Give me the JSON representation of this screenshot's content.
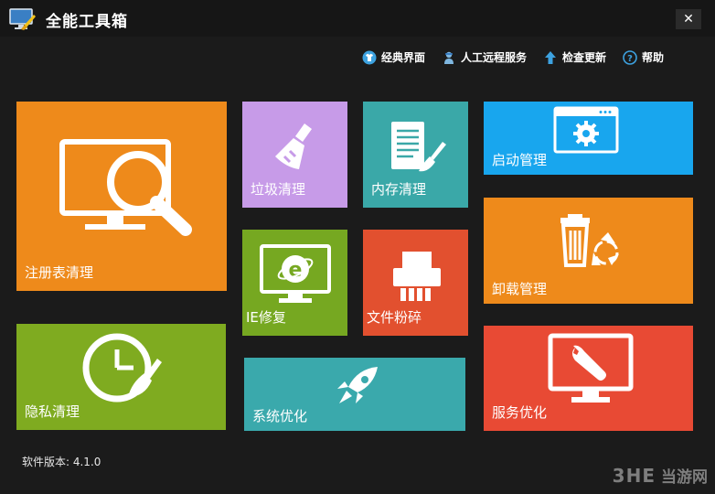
{
  "window": {
    "title": "全能工具箱",
    "close_glyph": "✕"
  },
  "toolbar": {
    "items": [
      {
        "label": "经典界面",
        "icon": "tshirt-icon"
      },
      {
        "label": "人工远程服务",
        "icon": "support-person-icon"
      },
      {
        "label": "检查更新",
        "icon": "arrow-up-icon"
      },
      {
        "label": "帮助",
        "icon": "help-icon"
      }
    ]
  },
  "tiles": {
    "registry": {
      "label": "注册表清理",
      "color": "#ee8a1b"
    },
    "junk": {
      "label": "垃圾清理",
      "color": "#c79be8"
    },
    "memory": {
      "label": "内存清理",
      "color": "#3aa8a8"
    },
    "startup": {
      "label": "启动管理",
      "color": "#18a6ee"
    },
    "ie_repair": {
      "label": "IE修复",
      "color": "#76a821"
    },
    "shred": {
      "label": "文件粉碎",
      "color": "#e2502f"
    },
    "uninstall": {
      "label": "卸载管理",
      "color": "#ee8a1b"
    },
    "privacy": {
      "label": "隐私清理",
      "color": "#7fab20"
    },
    "optimize": {
      "label": "系统优化",
      "color": "#3aa9ac"
    },
    "service": {
      "label": "服务优化",
      "color": "#e84a34"
    }
  },
  "footer": {
    "version": "软件版本: 4.1.0"
  },
  "watermark": {
    "text": "当游网",
    "logo_text": "3HE"
  }
}
